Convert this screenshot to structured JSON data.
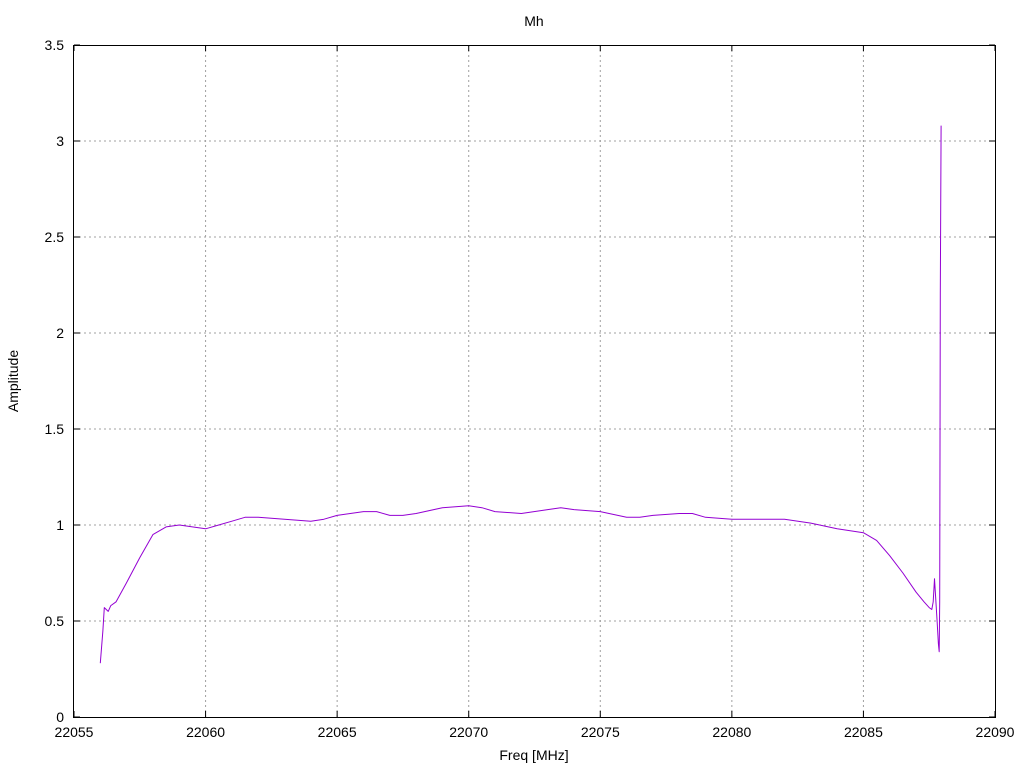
{
  "chart_data": {
    "type": "line",
    "title": "Mh",
    "xlabel": "Freq [MHz]",
    "ylabel": "Amplitude",
    "xlim": [
      22055,
      22090
    ],
    "ylim": [
      0,
      3.5
    ],
    "grid": true,
    "x_ticks": [
      "22055",
      "22060",
      "22065",
      "22070",
      "22075",
      "22080",
      "22085",
      "22090"
    ],
    "y_ticks": [
      "0",
      "0.5",
      "1",
      "1.5",
      "2",
      "2.5",
      "3",
      "3.5"
    ],
    "series": [
      {
        "color": "#9400d3",
        "x": [
          22056.0,
          22056.1,
          22056.15,
          22056.3,
          22056.4,
          22056.6,
          22057.0,
          22057.5,
          22058.0,
          22058.5,
          22059.0,
          22059.5,
          22060.0,
          22060.5,
          22061.0,
          22061.5,
          22062.0,
          22063.0,
          22064.0,
          22064.5,
          22065.0,
          22066.0,
          22066.5,
          22067.0,
          22067.5,
          22068.0,
          22069.0,
          22070.0,
          22070.5,
          22071.0,
          22072.0,
          22073.0,
          22073.5,
          22074.0,
          22075.0,
          22076.0,
          22076.5,
          22077.0,
          22078.0,
          22078.5,
          22079.0,
          22080.0,
          22081.0,
          22082.0,
          22083.0,
          22084.0,
          22085.0,
          22085.5,
          22086.0,
          22086.5,
          22087.0,
          22087.3,
          22087.5,
          22087.6,
          22087.65,
          22087.7,
          22087.8,
          22087.85,
          22087.88,
          22087.9,
          22087.92,
          22087.95
        ],
        "y": [
          0.28,
          0.45,
          0.57,
          0.55,
          0.58,
          0.6,
          0.7,
          0.83,
          0.95,
          0.99,
          1.0,
          0.99,
          0.98,
          1.0,
          1.02,
          1.04,
          1.04,
          1.03,
          1.02,
          1.03,
          1.05,
          1.07,
          1.07,
          1.05,
          1.05,
          1.06,
          1.09,
          1.1,
          1.09,
          1.07,
          1.06,
          1.08,
          1.09,
          1.08,
          1.07,
          1.04,
          1.04,
          1.05,
          1.06,
          1.06,
          1.04,
          1.03,
          1.03,
          1.03,
          1.01,
          0.98,
          0.96,
          0.92,
          0.84,
          0.75,
          0.65,
          0.6,
          0.57,
          0.56,
          0.6,
          0.72,
          0.5,
          0.38,
          0.34,
          0.6,
          2.2,
          3.08
        ]
      }
    ]
  }
}
